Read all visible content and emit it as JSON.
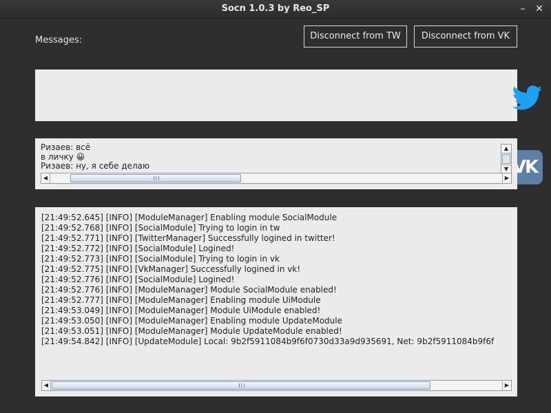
{
  "window": {
    "title": "Socn 1.0.3 by Reo_SP",
    "minimize_label": "–",
    "close_label": "✕"
  },
  "header": {
    "messages_label": "Messages:",
    "disconnect_tw_label": "Disconnect from TW",
    "disconnect_vk_label": "Disconnect from VK"
  },
  "input": {
    "value": ""
  },
  "icons": {
    "twitter": "twitter-bird-icon",
    "vk": "vk-logo-icon",
    "twitter_color": "#1da1f2",
    "vk_color": "#5b7fa6",
    "vk_text": "VK"
  },
  "chat": {
    "lines": [
      "Ризаев: всё",
      " в личку 😀",
      "Ризаев: ну, я себе делаю"
    ]
  },
  "log": {
    "lines": [
      "[21:49:52.645] [INFO] [ModuleManager] Enabling module SocialModule",
      "[21:49:52.768] [INFO] [SocialModule] Trying to login in tw",
      "[21:49:52.771] [INFO] [TwitterManager] Successfully logined in twitter!",
      "[21:49:52.772] [INFO] [SocialModule] Logined!",
      "[21:49:52.773] [INFO] [SocialModule] Trying to login in vk",
      "[21:49:52.775] [INFO] [VkManager] Successfully logined in vk!",
      "[21:49:52.776] [INFO] [SocialModule] Logined!",
      "[21:49:52.776] [INFO] [ModuleManager] Module SocialModule enabled!",
      "[21:49:52.777] [INFO] [ModuleManager] Enabling module UiModule",
      "[21:49:53.049] [INFO] [ModuleManager] Module UiModule enabled!",
      "[21:49:53.050] [INFO] [ModuleManager] Enabling module UpdateModule",
      "[21:49:53.051] [INFO] [ModuleManager] Module UpdateModule enabled!",
      "[21:49:54.842] [INFO] [UpdateModule] Local: 9b2f5911084b9f6f0730d33a9d935691, Net: 9b2f5911084b9f6f"
    ]
  },
  "scroll_arrows": {
    "up": "▲",
    "down": "▼",
    "left": "◀",
    "right": "▶"
  }
}
